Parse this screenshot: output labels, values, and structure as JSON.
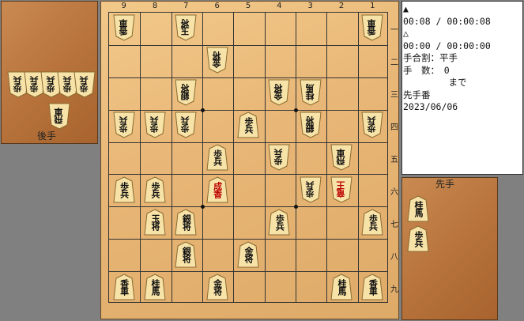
{
  "gote_stand": {
    "label": "後手",
    "pieces": [
      {
        "kanji": "歩兵",
        "count": 5
      },
      {
        "kanji": "飛車",
        "count": 1
      }
    ]
  },
  "sente_stand": {
    "label": "先手",
    "pieces": [
      {
        "kanji": "桂馬",
        "count": 1
      },
      {
        "kanji": "歩兵",
        "count": 1
      }
    ]
  },
  "board": {
    "files": [
      "9",
      "8",
      "7",
      "6",
      "5",
      "4",
      "3",
      "2",
      "1"
    ],
    "ranks": [
      "一",
      "二",
      "三",
      "四",
      "五",
      "六",
      "七",
      "八",
      "九"
    ],
    "pieces": [
      {
        "file": 9,
        "rank": 1,
        "kanji": "香車",
        "side": "gote"
      },
      {
        "file": 7,
        "rank": 1,
        "kanji": "玉将",
        "side": "gote"
      },
      {
        "file": 1,
        "rank": 1,
        "kanji": "香車",
        "side": "gote"
      },
      {
        "file": 6,
        "rank": 2,
        "kanji": "金将",
        "side": "gote"
      },
      {
        "file": 7,
        "rank": 3,
        "kanji": "銀将",
        "side": "gote"
      },
      {
        "file": 4,
        "rank": 3,
        "kanji": "金将",
        "side": "gote"
      },
      {
        "file": 3,
        "rank": 3,
        "kanji": "桂馬",
        "side": "gote"
      },
      {
        "file": 9,
        "rank": 4,
        "kanji": "歩兵",
        "side": "gote"
      },
      {
        "file": 8,
        "rank": 4,
        "kanji": "歩兵",
        "side": "gote"
      },
      {
        "file": 7,
        "rank": 4,
        "kanji": "歩兵",
        "side": "gote"
      },
      {
        "file": 5,
        "rank": 4,
        "kanji": "歩兵",
        "side": "sente"
      },
      {
        "file": 3,
        "rank": 4,
        "kanji": "銀将",
        "side": "gote"
      },
      {
        "file": 1,
        "rank": 4,
        "kanji": "歩兵",
        "side": "gote"
      },
      {
        "file": 6,
        "rank": 5,
        "kanji": "歩兵",
        "side": "sente"
      },
      {
        "file": 4,
        "rank": 5,
        "kanji": "歩兵",
        "side": "gote"
      },
      {
        "file": 2,
        "rank": 5,
        "kanji": "飛車",
        "side": "gote"
      },
      {
        "file": 9,
        "rank": 6,
        "kanji": "歩兵",
        "side": "sente"
      },
      {
        "file": 8,
        "rank": 6,
        "kanji": "歩兵",
        "side": "sente"
      },
      {
        "file": 6,
        "rank": 6,
        "kanji": "成香",
        "side": "sente",
        "promoted": true
      },
      {
        "file": 3,
        "rank": 6,
        "kanji": "歩兵",
        "side": "gote"
      },
      {
        "file": 2,
        "rank": 6,
        "kanji": "竜王",
        "side": "gote",
        "promoted": true
      },
      {
        "file": 8,
        "rank": 7,
        "kanji": "玉将",
        "side": "sente"
      },
      {
        "file": 7,
        "rank": 7,
        "kanji": "銀将",
        "side": "sente"
      },
      {
        "file": 4,
        "rank": 7,
        "kanji": "歩兵",
        "side": "sente"
      },
      {
        "file": 1,
        "rank": 7,
        "kanji": "歩兵",
        "side": "sente"
      },
      {
        "file": 7,
        "rank": 8,
        "kanji": "銀将",
        "side": "sente"
      },
      {
        "file": 5,
        "rank": 8,
        "kanji": "金将",
        "side": "sente"
      },
      {
        "file": 9,
        "rank": 9,
        "kanji": "香車",
        "side": "sente"
      },
      {
        "file": 8,
        "rank": 9,
        "kanji": "桂馬",
        "side": "sente"
      },
      {
        "file": 6,
        "rank": 9,
        "kanji": "金将",
        "side": "sente"
      },
      {
        "file": 2,
        "rank": 9,
        "kanji": "桂馬",
        "side": "sente"
      },
      {
        "file": 1,
        "rank": 9,
        "kanji": "香車",
        "side": "sente"
      }
    ]
  },
  "info": {
    "sente_mark": "▲",
    "sente_time": "00:08 / 00:00:08",
    "gote_mark": "△",
    "gote_time": "00:00 / 00:00:00",
    "handicap": "手合割：平手",
    "moves": "手　数：　0",
    "made": "　　　　　まで",
    "turn": "先手番",
    "date": "2023/06/06"
  },
  "colors": {
    "board": "#e8b676",
    "stand": "#b8743c",
    "piece_face": "#f7e3a8",
    "promoted_text": "#bb0000"
  }
}
